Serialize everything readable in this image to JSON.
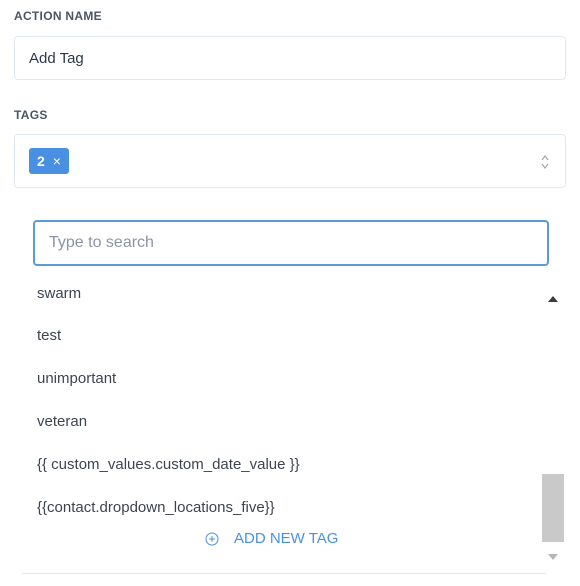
{
  "action_name": {
    "label": "ACTION NAME",
    "value": "Add Tag"
  },
  "tags": {
    "label": "TAGS",
    "selected_count": "2",
    "chip_remove_glyph": "×",
    "sort_icon": "chevron-up-down-icon"
  },
  "dropdown": {
    "search_placeholder": "Type to search",
    "options": [
      "swarm",
      "test",
      "unimportant",
      "veteran",
      "{{ custom_values.custom_date_value }}",
      "{{contact.dropdown_locations_five}}"
    ],
    "add_new_label": "ADD NEW TAG",
    "add_icon": "plus-circle-icon"
  },
  "colors": {
    "accent": "#4a90e2",
    "chip_bg": "#4a90e2",
    "search_border": "#5b9bd5",
    "border": "#e2e8f0",
    "scroll_thumb": "#c9c9c9"
  }
}
